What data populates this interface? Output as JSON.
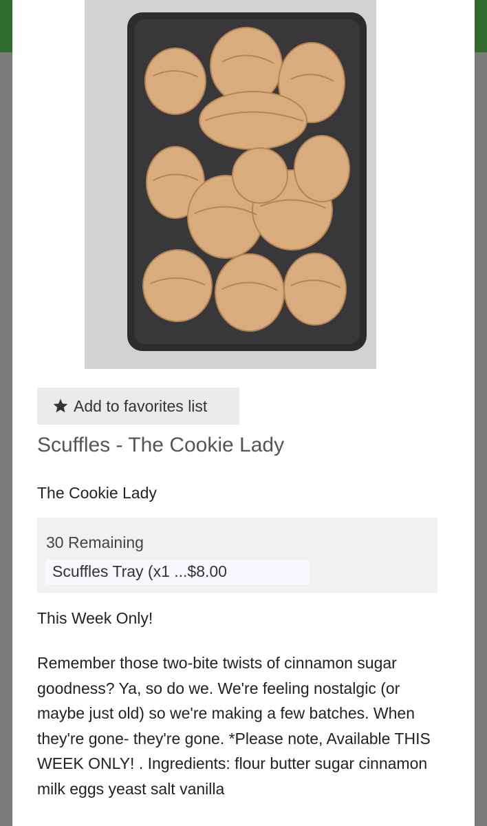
{
  "product": {
    "favorite_button_label": "Add to favorites list",
    "title": "Scuffles - The Cookie Lady",
    "vendor": "The Cookie Lady",
    "remaining": "30 Remaining",
    "selected_option": "Scuffles Tray (x1 ...$8.00",
    "tagline": "This Week Only!",
    "description": "Remember those two-bite twists of cinnamon sugar goodness? Ya, so do we. We're feeling nostalgic (or maybe just old) so we're making a few batches. When they're gone- they're gone. *Please note, Available THIS WEEK ONLY! . Ingredients: flour butter sugar cinnamon milk eggs yeast salt vanilla"
  },
  "icons": {
    "favorite": "star-icon"
  },
  "colors": {
    "header_green": "#2f6b2a",
    "overlay_gray": "#7a7a7a",
    "button_bg": "#ebebeb",
    "option_box_bg": "#f1f1f1"
  }
}
